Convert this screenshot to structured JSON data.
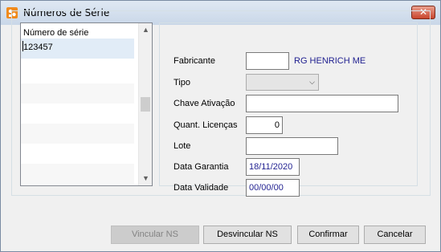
{
  "window": {
    "title": "Números de Série",
    "close_glyph": "✕"
  },
  "serial_list": {
    "header": "Número de série",
    "rows": [
      "123457",
      "",
      "",
      "",
      "",
      "",
      ""
    ]
  },
  "form": {
    "fabricante_label": "Fabricante",
    "fabricante_code": "",
    "fabricante_name": "RG HENRICH ME",
    "tipo_label": "Tipo",
    "tipo_value": "",
    "chave_label": "Chave Ativação",
    "chave_value": "",
    "quant_label": "Quant. Licenças",
    "quant_value": "0",
    "lote_label": "Lote",
    "lote_value": "",
    "garantia_label": "Data Garantia",
    "garantia_value": "18/11/2020",
    "validade_label": "Data Validade",
    "validade_value": "00/00/00"
  },
  "buttons": {
    "vincular": "Vincular NS",
    "desvincular": "Desvincular NS",
    "confirmar": "Confirmar",
    "cancelar": "Cancelar"
  },
  "icons": {
    "app": "app-icon",
    "scroll_up": "▲",
    "scroll_down": "▼",
    "dropdown": "⌵"
  }
}
